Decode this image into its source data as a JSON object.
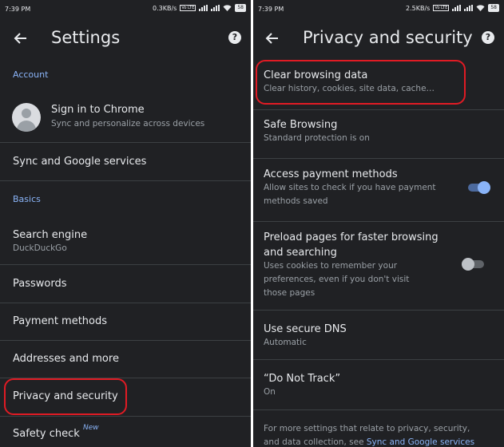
{
  "left": {
    "status": {
      "time": "7:39 PM",
      "net_speed": "0.3KB/s",
      "volte": "Vo LTE",
      "battery": "58"
    },
    "appbar": {
      "title": "Settings",
      "help": "?"
    },
    "sections": {
      "account": "Account",
      "basics": "Basics"
    },
    "account": {
      "title": "Sign in to Chrome",
      "subtitle": "Sync and personalize across devices"
    },
    "sync": {
      "title": "Sync and Google services"
    },
    "search_engine": {
      "title": "Search engine",
      "subtitle": "DuckDuckGo"
    },
    "passwords": {
      "title": "Passwords"
    },
    "payment_methods": {
      "title": "Payment methods"
    },
    "addresses": {
      "title": "Addresses and more"
    },
    "privacy": {
      "title": "Privacy and security"
    },
    "safety_check": {
      "title": "Safety check",
      "badge": "New"
    }
  },
  "right": {
    "status": {
      "time": "7:39 PM",
      "net_speed": "2.5KB/s",
      "volte": "Vo LTE",
      "battery": "58"
    },
    "appbar": {
      "title": "Privacy and security",
      "help": "?"
    },
    "clear_browsing": {
      "title": "Clear browsing data",
      "subtitle": "Clear history, cookies, site data, cache…"
    },
    "safe_browsing": {
      "title": "Safe Browsing",
      "subtitle": "Standard protection is on"
    },
    "access_payment": {
      "title": "Access payment methods",
      "subtitle_1": "Allow sites to check if you have payment",
      "subtitle_2": "methods saved",
      "toggle_on": true
    },
    "preload": {
      "title_1": "Preload pages for faster browsing",
      "title_2": "and searching",
      "subtitle_1": "Uses cookies to remember your",
      "subtitle_2": "preferences, even if you don't visit",
      "subtitle_3": "those pages",
      "toggle_on": false
    },
    "secure_dns": {
      "title": "Use secure DNS",
      "subtitle": "Automatic"
    },
    "do_not_track": {
      "title": "“Do Not Track”",
      "subtitle": "On"
    },
    "footer": {
      "text_1": "For more settings that relate to privacy, security,",
      "text_2": "and data collection, see ",
      "link": "Sync and Google services"
    }
  },
  "colors": {
    "background": "#202124",
    "accent": "#8ab4f8",
    "highlight": "#e01b24"
  },
  "icons": {
    "back": "back-arrow-icon",
    "help": "help-icon",
    "avatar": "avatar-icon"
  }
}
